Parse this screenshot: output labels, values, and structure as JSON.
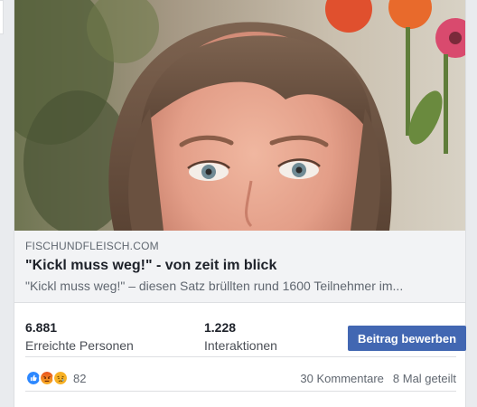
{
  "link_preview": {
    "domain": "FISCHUNDFLEISCH.COM",
    "title": "\"Kickl muss weg!\" - von zeit im blick",
    "description": "\"Kickl muss weg!\" – diesen Satz brüllten rund 1600 Teilnehmer im..."
  },
  "stats": {
    "reach_value": "6.881",
    "reach_label": "Erreichte Personen",
    "engagement_value": "1.228",
    "engagement_label": "Interaktionen",
    "boost_label": "Beitrag bewerben"
  },
  "footer": {
    "reactions": [
      "like-icon",
      "angry-icon",
      "sad-icon"
    ],
    "reaction_count": "82",
    "comments": "30 Kommentare",
    "shares": "8 Mal geteilt"
  },
  "colors": {
    "accent": "#4267b2",
    "like": "#2d88ff",
    "angry": "#e9710f",
    "sad": "#f7b125"
  }
}
